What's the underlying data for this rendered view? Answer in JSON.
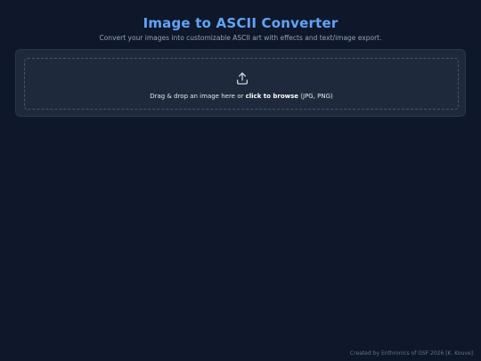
{
  "header": {
    "title": "Image to ASCII Converter",
    "subtitle": "Convert your images into customizable ASCII art with effects and text/image export."
  },
  "upload": {
    "icon": "upload-icon",
    "text_prefix": "Drag & drop an image here or ",
    "browse_label": "click to browse",
    "formats": " (JPG, PNG)"
  },
  "footer": {
    "credit": "Created by Enthronics of GSF 2026 [K. Kouve]"
  },
  "colors": {
    "background": "#0f172a",
    "card": "#1e293b",
    "accent": "#60a5fa"
  }
}
